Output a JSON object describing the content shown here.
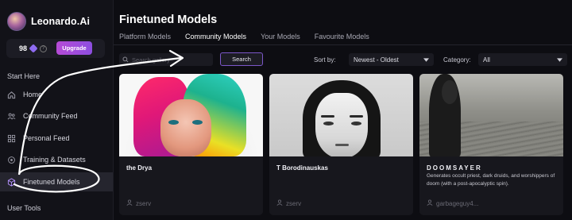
{
  "brand": {
    "name": "Leonardo.Ai"
  },
  "account": {
    "tokens": "98",
    "upgrade_label": "Upgrade"
  },
  "sidebar": {
    "section1": "Start Here",
    "items": [
      {
        "label": "Home",
        "icon": "home-icon"
      },
      {
        "label": "Community Feed",
        "icon": "community-icon"
      },
      {
        "label": "Personal Feed",
        "icon": "grid-icon"
      },
      {
        "label": "Training & Datasets",
        "icon": "training-icon"
      },
      {
        "label": "Finetuned Models",
        "icon": "cube-icon",
        "active": true
      }
    ],
    "section2": "User Tools"
  },
  "main": {
    "title": "Finetuned Models",
    "tabs": [
      {
        "label": "Platform Models"
      },
      {
        "label": "Community Models",
        "active": true
      },
      {
        "label": "Your Models"
      },
      {
        "label": "Favourite Models"
      }
    ],
    "search": {
      "placeholder": "Search gallery",
      "button_label": "Search"
    },
    "sort": {
      "label": "Sort by:",
      "value": "Newest - Oldest"
    },
    "category": {
      "label": "Category:",
      "value": "All"
    }
  },
  "cards": [
    {
      "title": "the Drya",
      "description": "",
      "user": "zserv"
    },
    {
      "title": "T Borodinauskas",
      "description": "",
      "user": "zserv"
    },
    {
      "title": "DOOMSAYER",
      "description": "Generates occult priest, dark druids, and worshippers of doom (with a post-apocalyptic spin).",
      "user": "garbageguy4..."
    }
  ],
  "colors": {
    "accent": "#9d4fe0",
    "active_tab": "#c9a6ff"
  }
}
